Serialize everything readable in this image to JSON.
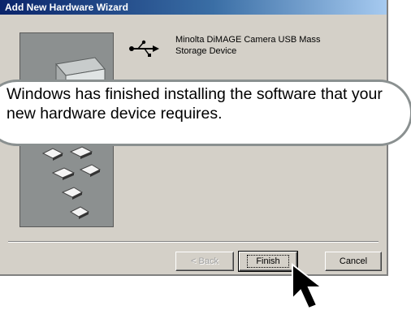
{
  "window": {
    "title": "Add New Hardware Wizard"
  },
  "device": {
    "icon": "usb-icon",
    "name": "Minolta DiMAGE Camera USB Mass Storage Device"
  },
  "message": {
    "text": "Windows has finished installing the software that your new hardware device requires."
  },
  "buttons": {
    "back_label": "< Back",
    "finish_label": "Finish",
    "cancel_label": "Cancel"
  }
}
